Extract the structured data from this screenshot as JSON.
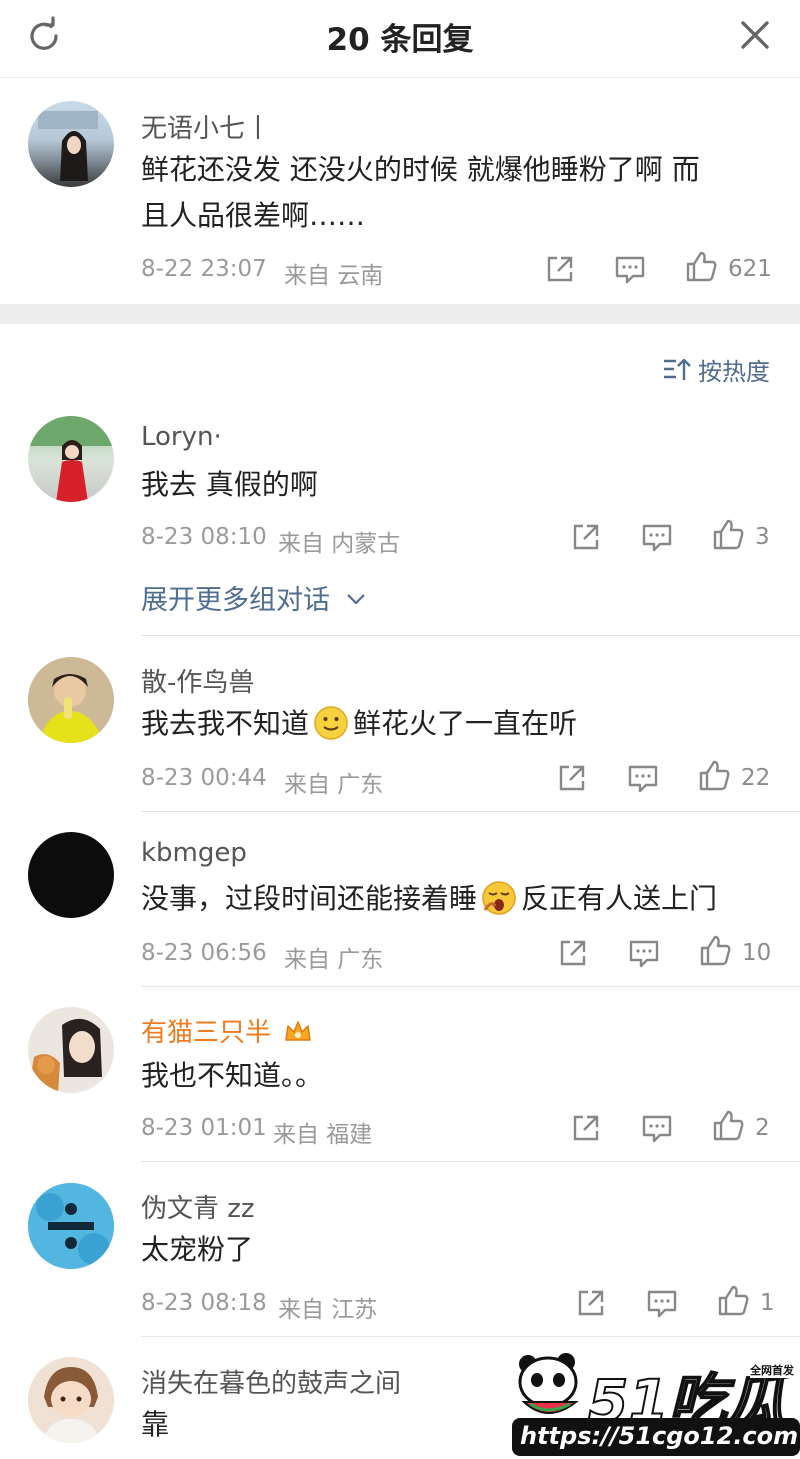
{
  "header": {
    "title": "20 条回复"
  },
  "root_comment": {
    "user": "无语小七丨",
    "text_line1": "鲜花还没发 还没火的时候 就爆他睡粉了啊 而",
    "text_line2": "且人品很差啊……",
    "time": "8-22 23:07",
    "location": "来自 云南",
    "likes": "621"
  },
  "sort": {
    "label": "按热度"
  },
  "replies": [
    {
      "user": "Loryn·",
      "text": "我去 真假的啊",
      "time": "8-23 08:10",
      "location": "来自 内蒙古",
      "likes": "3"
    },
    {
      "user": "散-作鸟兽",
      "text_a": "我去我不知道",
      "text_b": "鲜花火了一直在听",
      "time": "8-23 00:44",
      "location": "来自 广东",
      "likes": "22"
    },
    {
      "user": "kbmgep",
      "text_a": "没事，过段时间还能接着睡",
      "text_b": "反正有人送上门",
      "time": "8-23 06:56",
      "location": "来自 广东",
      "likes": "10"
    },
    {
      "user": "有猫三只半",
      "text": "我也不知道。。",
      "time": "8-23 01:01",
      "location": "来自 福建",
      "likes": "2"
    },
    {
      "user": "伪文青 zz",
      "text": "太宠粉了",
      "time": "8-23 08:18",
      "location": "来自 江苏",
      "likes": "1"
    },
    {
      "user": "消失在暮色的鼓声之间",
      "text": "靠"
    }
  ],
  "expand_label": "展开更多组对话",
  "watermark": {
    "brand": "51吃瓜",
    "tag": "全网首发",
    "url": "https://51cgo12.com"
  },
  "colors": {
    "link": "#4f6d91",
    "vip_name": "#f07a1e",
    "meta": "#9a9a9a"
  }
}
